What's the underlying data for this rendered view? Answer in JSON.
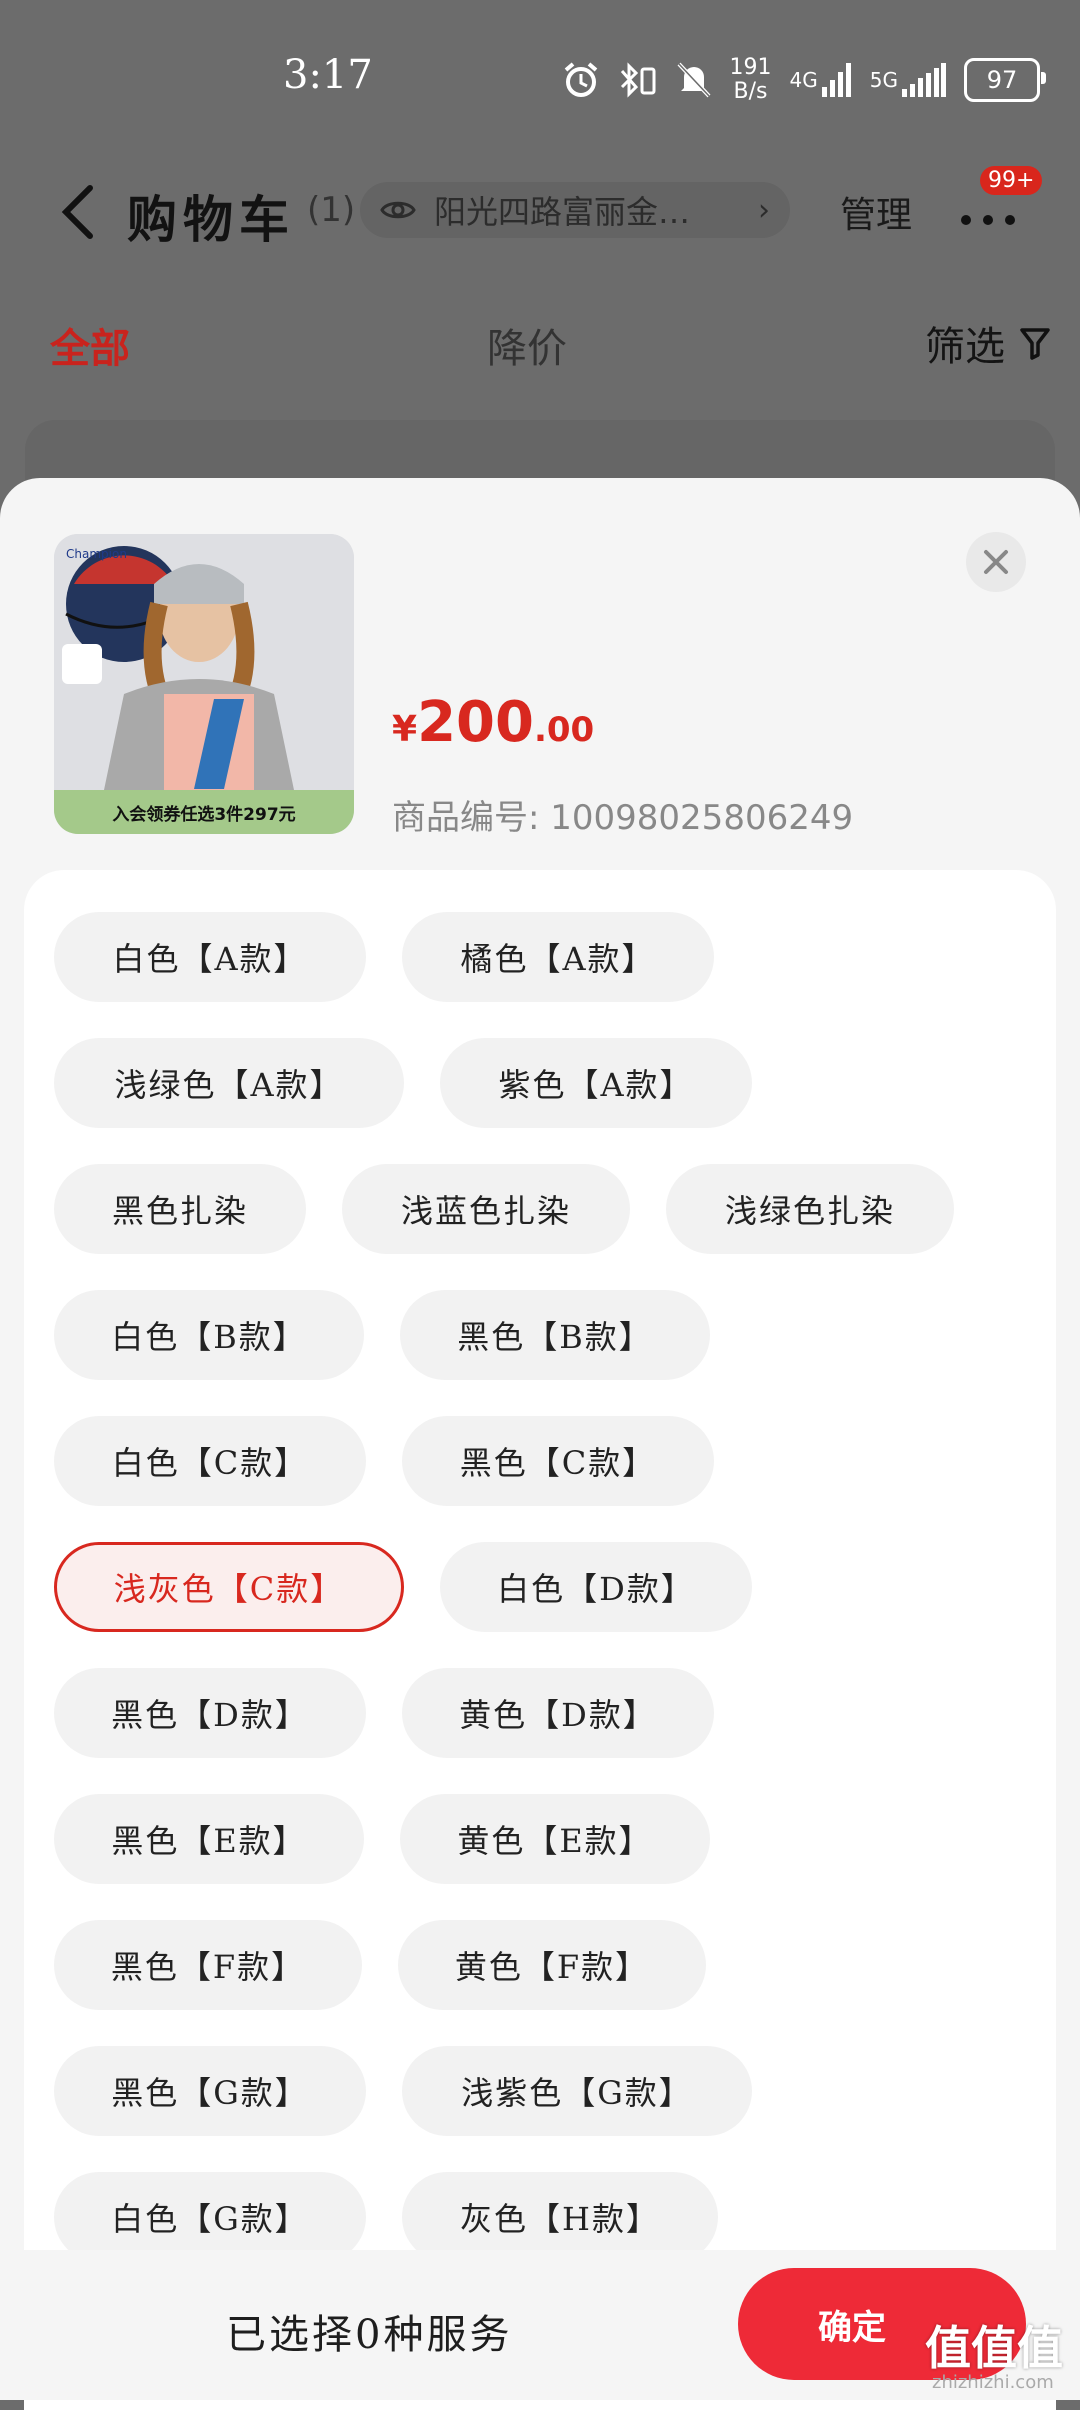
{
  "status_bar": {
    "time": "3:17",
    "net_speed_value": "191",
    "net_speed_unit": "B/s",
    "signal1": "4G",
    "signal2": "5G",
    "battery": "97"
  },
  "header": {
    "title": "购物车",
    "count": "(1)",
    "address": "阳光四路富丽金…",
    "manage": "管理",
    "badge": "99+"
  },
  "tabs": {
    "all": "全部",
    "price_drop": "降价",
    "filter": "筛选"
  },
  "product": {
    "promo": "入会领券任选3件297元",
    "price_symbol": "¥",
    "price_int": "200",
    "price_dec": ".00",
    "sku": "商品编号: 10098025806249"
  },
  "options": [
    [
      "白色【A款】",
      "橘色【A款】"
    ],
    [
      "浅绿色【A款】",
      "紫色【A款】"
    ],
    [
      "黑色扎染",
      "浅蓝色扎染",
      "浅绿色扎染"
    ],
    [
      "白色【B款】",
      "黑色【B款】"
    ],
    [
      "白色【C款】",
      "黑色【C款】"
    ],
    [
      "浅灰色【C款】",
      "白色【D款】"
    ],
    [
      "黑色【D款】",
      "黄色【D款】"
    ],
    [
      "黑色【E款】",
      "黄色【E款】"
    ],
    [
      "黑色【F款】",
      "黄色【F款】"
    ],
    [
      "黑色【G款】",
      "浅紫色【G款】"
    ],
    [
      "白色【G款】",
      "灰色【H款】"
    ]
  ],
  "selected_option": "浅灰色【C款】",
  "bottom": {
    "selected_text": "已选择0种服务",
    "confirm": "确定",
    "watermark": "值值值",
    "watermark_url": "zhizhizhi.com"
  },
  "colors": {
    "accent": "#d8281f",
    "confirm": "#ee2a37",
    "overlay": "#6c6c6c"
  }
}
